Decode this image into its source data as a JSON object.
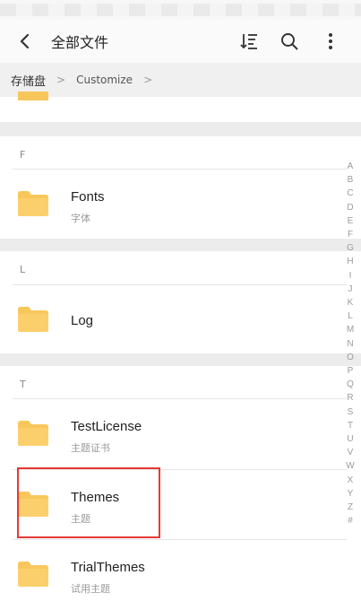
{
  "header": {
    "title": "全部文件",
    "back_icon": "chevron-left-icon",
    "sort_icon": "sort-icon",
    "search_icon": "search-icon",
    "more_icon": "more-vertical-icon"
  },
  "breadcrumb": {
    "root": "存储盘",
    "items": [
      "Customize"
    ]
  },
  "sections": [
    {
      "letter": "F",
      "items": [
        {
          "name": "Fonts",
          "subtitle": "字体"
        }
      ]
    },
    {
      "letter": "L",
      "items": [
        {
          "name": "Log",
          "subtitle": ""
        }
      ]
    },
    {
      "letter": "T",
      "items": [
        {
          "name": "TestLicense",
          "subtitle": "主题证书"
        },
        {
          "name": "Themes",
          "subtitle": "主题"
        },
        {
          "name": "TrialThemes",
          "subtitle": "试用主题"
        }
      ]
    }
  ],
  "alpha_index": [
    "A",
    "B",
    "C",
    "D",
    "E",
    "F",
    "G",
    "H",
    "I",
    "J",
    "K",
    "L",
    "M",
    "N",
    "O",
    "P",
    "Q",
    "R",
    "S",
    "T",
    "U",
    "V",
    "W",
    "X",
    "Y",
    "Z",
    "#"
  ],
  "colors": {
    "folder": "#f8c75c",
    "highlight": "#e53935"
  }
}
